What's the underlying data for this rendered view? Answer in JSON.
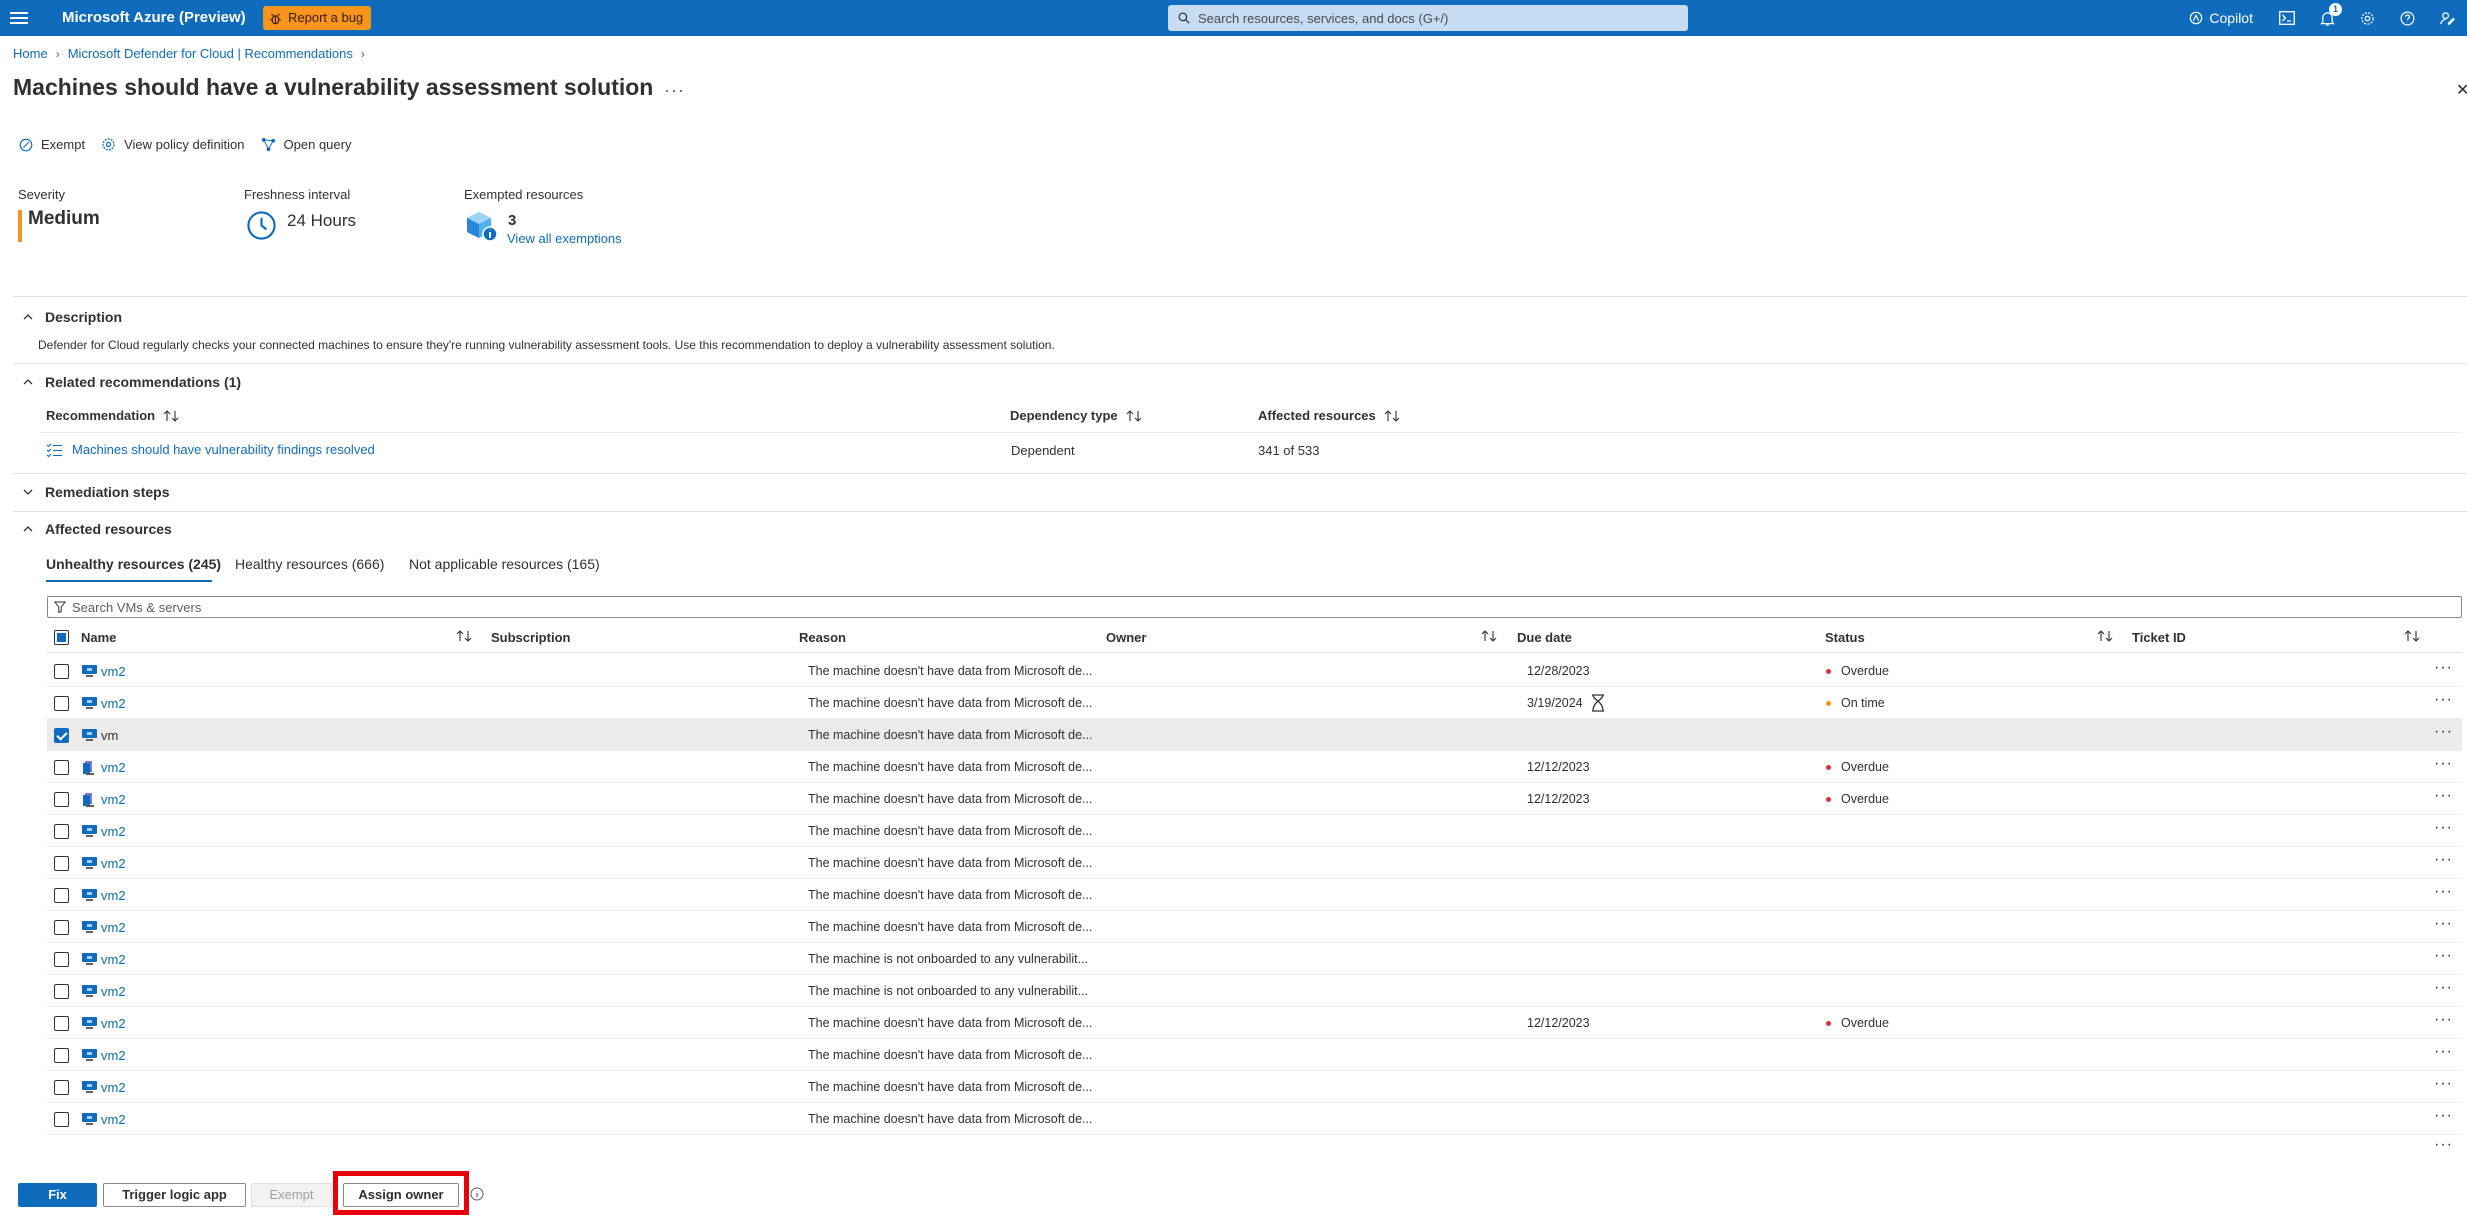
{
  "topbar": {
    "brand": "Microsoft Azure (Preview)",
    "bug_label": "Report a bug",
    "search_placeholder": "Search resources, services, and docs (G+/)",
    "copilot_label": "Copilot",
    "notification_count": "1"
  },
  "breadcrumb": {
    "items": [
      "Home",
      "Microsoft Defender for Cloud | Recommendations"
    ]
  },
  "page": {
    "title": "Machines should have a vulnerability assessment solution",
    "more": "···"
  },
  "commands": {
    "exempt": "Exempt",
    "view_policy": "View policy definition",
    "open_query": "Open query"
  },
  "essentials": {
    "severity_label": "Severity",
    "severity_value": "Medium",
    "freshness_label": "Freshness interval",
    "freshness_value": "24 Hours",
    "exempted_label": "Exempted resources",
    "exempted_count": "3",
    "view_exemptions": "View all exemptions"
  },
  "description": {
    "heading": "Description",
    "text": "Defender for Cloud regularly checks your connected machines to ensure they're running vulnerability assessment tools. Use this recommendation to deploy a vulnerability assessment solution."
  },
  "related": {
    "heading": "Related recommendations (1)",
    "columns": [
      "Recommendation",
      "Dependency type",
      "Affected resources"
    ],
    "rows": [
      {
        "recommendation": "Machines should have vulnerability findings resolved",
        "dependency": "Dependent",
        "affected": "341 of 533"
      }
    ]
  },
  "remediation": {
    "heading": "Remediation steps"
  },
  "affected": {
    "heading": "Affected resources",
    "tabs": [
      "Unhealthy resources (245)",
      "Healthy resources (666)",
      "Not applicable resources (165)"
    ],
    "search_placeholder": "Search VMs & servers",
    "columns": [
      "Name",
      "Subscription",
      "Reason",
      "Owner",
      "Due date",
      "Status",
      "Ticket ID"
    ],
    "rows": [
      {
        "name": "vm2",
        "reason": "The machine doesn't have data from Microsoft de...",
        "due": "12/28/2023",
        "status": "Overdue"
      },
      {
        "name": "vm2",
        "reason": "The machine doesn't have data from Microsoft de...",
        "due": "3/19/2024",
        "status": "On time"
      },
      {
        "name": "vm",
        "reason": "The machine doesn't have data from Microsoft de...",
        "due": "",
        "status": ""
      },
      {
        "name": "vm2",
        "reason": "The machine doesn't have data from Microsoft de...",
        "due": "12/12/2023",
        "status": "Overdue"
      },
      {
        "name": "vm2",
        "reason": "The machine doesn't have data from Microsoft de...",
        "due": "12/12/2023",
        "status": "Overdue"
      },
      {
        "name": "vm2",
        "reason": "The machine doesn't have data from Microsoft de...",
        "due": "",
        "status": ""
      },
      {
        "name": "vm2",
        "reason": "The machine doesn't have data from Microsoft de...",
        "due": "",
        "status": ""
      },
      {
        "name": "vm2",
        "reason": "The machine doesn't have data from Microsoft de...",
        "due": "",
        "status": ""
      },
      {
        "name": "vm2",
        "reason": "The machine doesn't have data from Microsoft de...",
        "due": "",
        "status": ""
      },
      {
        "name": "vm2",
        "reason": "The machine is not onboarded to any vulnerabilit...",
        "due": "",
        "status": ""
      },
      {
        "name": "vm2",
        "reason": "The machine is not onboarded to any vulnerabilit...",
        "due": "",
        "status": ""
      },
      {
        "name": "vm2",
        "reason": "The machine doesn't have data from Microsoft de...",
        "due": "12/12/2023",
        "status": "Overdue"
      },
      {
        "name": "vm2",
        "reason": "The machine doesn't have data from Microsoft de...",
        "due": "",
        "status": ""
      },
      {
        "name": "vm2",
        "reason": "The machine doesn't have data from Microsoft de...",
        "due": "",
        "status": ""
      },
      {
        "name": "vm2",
        "reason": "The machine doesn't have data from Microsoft de...",
        "due": "",
        "status": ""
      }
    ]
  },
  "actions": {
    "fix": "Fix",
    "trigger_logic_app": "Trigger logic app",
    "exempt": "Exempt",
    "assign_owner": "Assign owner"
  },
  "colors": {
    "accent": "#0f6cbd",
    "overdue": "#d13438",
    "on_time": "#f7941d",
    "severity_medium": "#f7941d",
    "highlight": "#e8000d"
  }
}
